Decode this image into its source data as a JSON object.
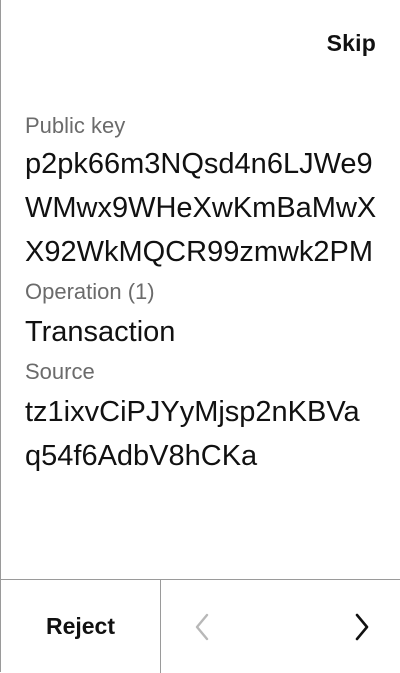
{
  "header": {
    "skip_label": "Skip"
  },
  "review": {
    "public_key_label": "Public key",
    "public_key_value": "p2pk66m3NQsd4n6LJWe9WMwx9WHeXwKmBaMwXX92WkMQCR99zmwk2PM",
    "operation_label": "Operation (1)",
    "operation_value": "Transaction",
    "source_label": "Source",
    "source_value": "tz1ixvCiPJYyMjsp2nKBVaq54f6AdbV8hCKa"
  },
  "footer": {
    "reject_label": "Reject",
    "prev_icon": "chevron-left-icon",
    "next_icon": "chevron-right-icon",
    "prev_enabled": false,
    "next_enabled": true
  },
  "colors": {
    "text": "#111111",
    "label": "#6b6b6b",
    "divider": "#9a9a9a",
    "disabled": "#b8b8b8"
  }
}
